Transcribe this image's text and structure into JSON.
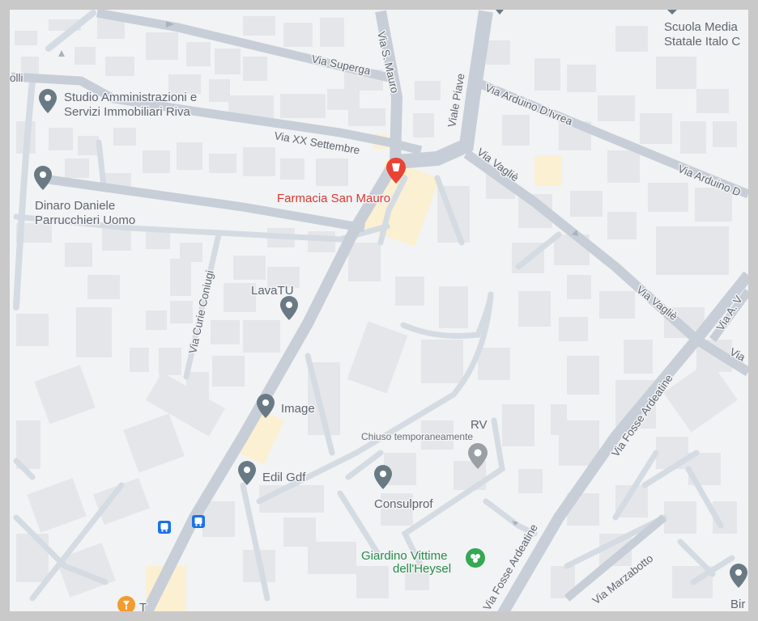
{
  "map": {
    "streets": {
      "via_superga": "Via Superga",
      "via_s_mauro": "Via S. Mauro",
      "viale_piave": "Viale Piave",
      "via_arduino_divrea": "Via Arduino D'Ivrea",
      "via_arduino_d": "Via Arduino D",
      "via_xx_settembre": "Via XX Settembre",
      "via_vaglie_1": "Via Vagliè",
      "via_vaglie_2": "Via Vagliè",
      "via_curie_coniugi": "Via Curie Coniugi",
      "via_fosse_ardeatine_1": "Via Fosse Ardeatine",
      "via_fosse_ardeatine_2": "Via Fosse Ardeatine",
      "via_a_v": "Via A. V",
      "via_partial": "Via",
      "via_marzabotto": "Via Marzabotto",
      "olli_partial": "olli"
    },
    "pois": {
      "studio_line1": "Studio Amministrazioni e",
      "studio_line2": "Servizi Immobiliari Riva",
      "dinaro_line1": "Dinaro Daniele",
      "dinaro_line2": "Parrucchieri Uomo",
      "farmacia": "Farmacia San Mauro",
      "lavatu": "LavaTU",
      "image": "Image",
      "edil_gdf": "Edil Gdf",
      "consulprof": "Consulprof",
      "rv": "RV",
      "rv_status": "Chiuso temporaneamente",
      "giardino_line1": "Giardino Vittime",
      "giardino_line2": "dell'Heysel",
      "scuola_line1": "Scuola Media",
      "scuola_line2": "Statale Italo C",
      "bir": "Bir",
      "tail_partial": "T"
    },
    "colors": {
      "background": "#f2f3f5",
      "frame": "#c9c9c9",
      "pin_default": "#6a7a84",
      "pin_pharmacy": "#ea4335",
      "pin_park": "#34a853",
      "pin_food": "#f29b2f",
      "transit": "#1a73e8"
    }
  }
}
